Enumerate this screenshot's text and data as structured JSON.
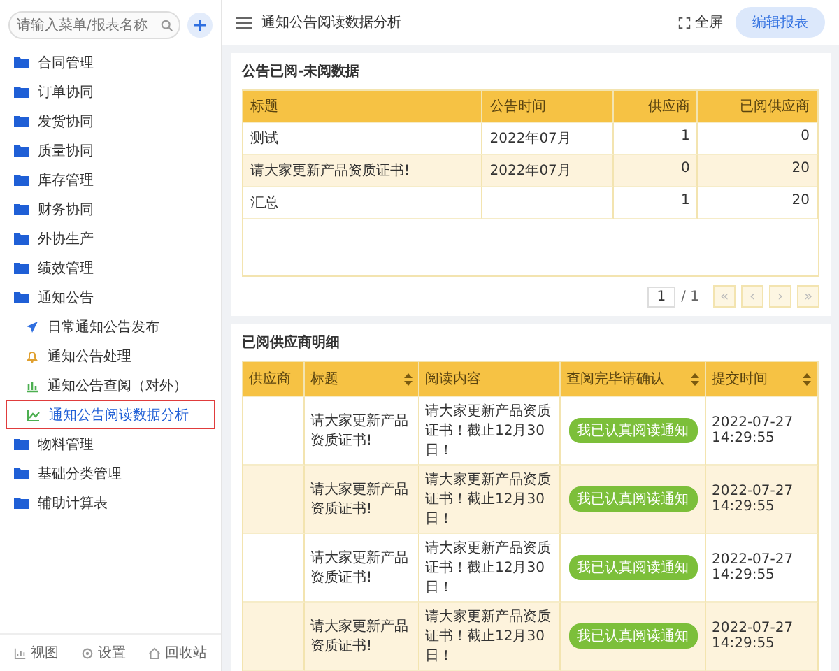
{
  "sidebar": {
    "search": {
      "placeholder": "请输入菜单/报表名称"
    },
    "items": [
      {
        "label": "合同管理",
        "selected": false
      },
      {
        "label": "订单协同",
        "selected": false
      },
      {
        "label": "发货协同",
        "selected": false
      },
      {
        "label": "质量协同",
        "selected": false
      },
      {
        "label": "库存管理",
        "selected": false
      },
      {
        "label": "财务协同",
        "selected": false
      },
      {
        "label": "外协生产",
        "selected": false
      },
      {
        "label": "绩效管理",
        "selected": false
      },
      {
        "label": "通知公告",
        "selected": false,
        "children": [
          {
            "label": "日常通知公告发布",
            "kind": "send",
            "selected": false
          },
          {
            "label": "通知公告处理",
            "kind": "bell",
            "selected": false
          },
          {
            "label": "通知公告查阅（对外）",
            "kind": "bars",
            "selected": false
          },
          {
            "label": "通知公告阅读数据分析",
            "kind": "line",
            "selected": true
          }
        ]
      },
      {
        "label": "物料管理",
        "selected": false
      },
      {
        "label": "基础分类管理",
        "selected": false
      },
      {
        "label": "辅助计算表",
        "selected": false
      }
    ],
    "footer": [
      {
        "label": "视图",
        "kind": "view"
      },
      {
        "label": "设置",
        "kind": "gear"
      },
      {
        "label": "回收站",
        "kind": "trash"
      }
    ]
  },
  "header": {
    "title": "通知公告阅读数据分析",
    "fullscreen": "全屏",
    "edit": "编辑报表"
  },
  "summary": {
    "title": "公告已阅-未阅数据",
    "columns": [
      "标题",
      "公告时间",
      "供应商",
      "已阅供应商"
    ],
    "rows": [
      [
        "测试",
        "2022年07月",
        "1",
        "0"
      ],
      [
        "请大家更新产品资质证书!",
        "2022年07月",
        "0",
        "20"
      ],
      [
        "汇总",
        "",
        "1",
        "20"
      ]
    ],
    "pager": {
      "page": "1",
      "total": "/ 1",
      "buttons": [
        "«",
        "‹",
        "›",
        "»"
      ]
    }
  },
  "detail": {
    "title": "已阅供应商明细",
    "columns": [
      {
        "label": "供应商",
        "sortable": false
      },
      {
        "label": "标题",
        "sortable": true
      },
      {
        "label": "阅读内容",
        "sortable": false
      },
      {
        "label": "查阅完毕请确认",
        "sortable": true
      },
      {
        "label": "提交时间",
        "sortable": true
      }
    ],
    "rows": [
      {
        "supplier": "",
        "title": "请大家更新产品资质证书!",
        "content": "请大家更新产品资质证书！截止12月30日！",
        "confirm": "我已认真阅读通知",
        "time": "2022-07-27 14:29:55"
      },
      {
        "supplier": "",
        "title": "请大家更新产品资质证书!",
        "content": "请大家更新产品资质证书！截止12月30日！",
        "confirm": "我已认真阅读通知",
        "time": "2022-07-27 14:29:55"
      },
      {
        "supplier": "",
        "title": "请大家更新产品资质证书!",
        "content": "请大家更新产品资质证书！截止12月30日！",
        "confirm": "我已认真阅读通知",
        "time": "2022-07-27 14:29:55"
      },
      {
        "supplier": "",
        "title": "请大家更新产品资质证书!",
        "content": "请大家更新产品资质证书！截止12月30日！",
        "confirm": "我已认真阅读通知",
        "time": "2022-07-27 14:29:55"
      }
    ]
  }
}
